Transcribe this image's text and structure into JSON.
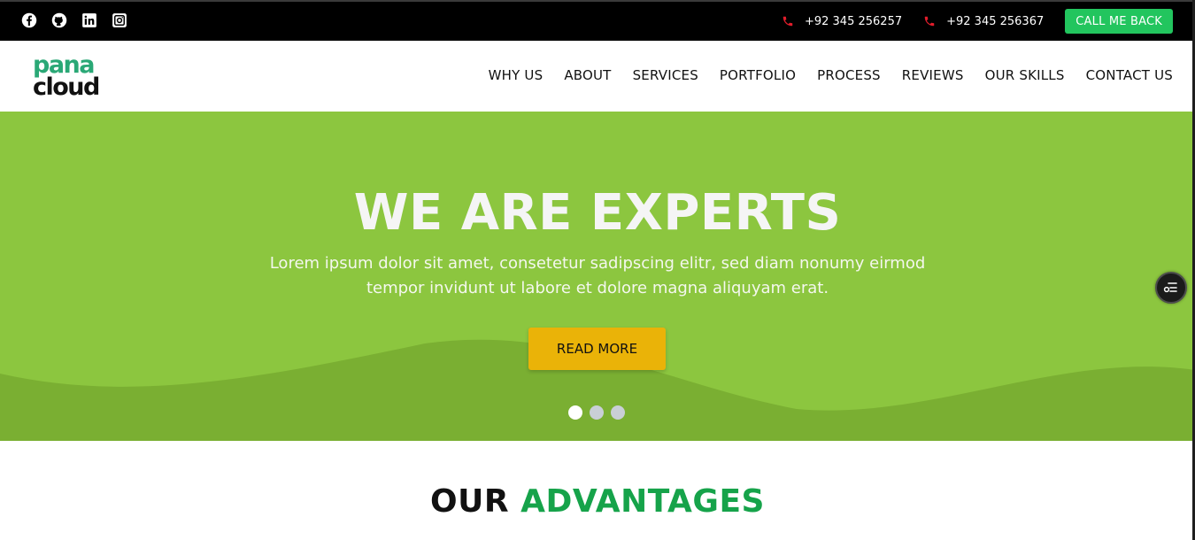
{
  "topbar": {
    "social": [
      "facebook-icon",
      "github-icon",
      "linkedin-icon",
      "instagram-icon"
    ],
    "phones": [
      "+92 345 256257",
      "+92 345 256367"
    ],
    "callback_label": "CALL ME BACK"
  },
  "brand": {
    "line1": "pana",
    "line2": "cloud"
  },
  "nav": {
    "items": [
      "WHY US",
      "ABOUT",
      "SERVICES",
      "PORTFOLIO",
      "PROCESS",
      "REVIEWS",
      "OUR SKILLS",
      "CONTACT US"
    ]
  },
  "hero": {
    "title": "WE ARE EXPERTS",
    "text": "Lorem ipsum dolor sit amet, consetetur sadipscing elitr, sed diam nonumy eirmod tempor invidunt ut labore et dolore magna aliquyam erat.",
    "button_label": "READ MORE",
    "slides": 3,
    "active_slide": 1
  },
  "advantages": {
    "title_part1": "OUR",
    "title_part2": "ADVANTAGES"
  },
  "colors": {
    "topbar_bg": "#000000",
    "hero_green": "#8cc63f",
    "hero_wave": "#7aaf32",
    "callback_green": "#22c55e",
    "readmore_yellow": "#eab308",
    "accent_green": "#16a34a",
    "logo_green": "#2aa876",
    "phone_icon_red": "#e11d2b"
  }
}
